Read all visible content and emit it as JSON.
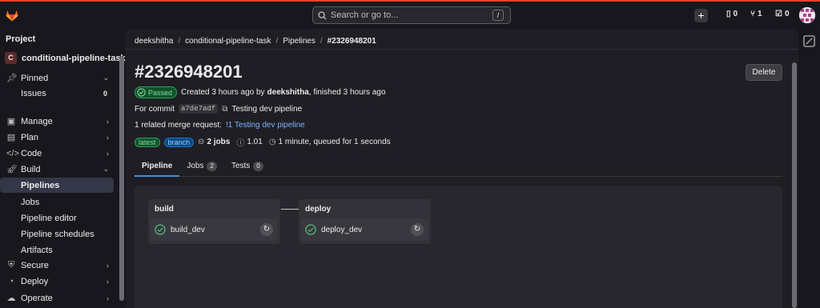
{
  "topbar": {
    "search_placeholder": "Search or go to...",
    "search_shortcut": "/",
    "issues_count": "0",
    "mr_count": "1",
    "todo_count": "0"
  },
  "sidebar": {
    "section_label": "Project",
    "repo_initial": "C",
    "repo_name": "conditional-pipeline-task",
    "items": {
      "pinned": "Pinned",
      "issues": "Issues",
      "issues_count": "0",
      "manage": "Manage",
      "plan": "Plan",
      "code": "Code",
      "build": "Build",
      "pipelines": "Pipelines",
      "jobs": "Jobs",
      "pipeline_editor": "Pipeline editor",
      "pipeline_schedules": "Pipeline schedules",
      "artifacts": "Artifacts",
      "secure": "Secure",
      "deploy": "Deploy",
      "operate": "Operate"
    }
  },
  "breadcrumb": {
    "user": "deekshitha",
    "project": "conditional-pipeline-task",
    "section": "Pipelines",
    "current": "#2326948201"
  },
  "pipeline": {
    "title": "#2326948201",
    "delete_label": "Delete",
    "status": "Passed",
    "created_text": "Created 3 hours ago by",
    "author": "deekshitha",
    "finished_text": ", finished 3 hours ago",
    "commit_prefix": "For commit",
    "commit_sha": "a7de7adf",
    "commit_message": "Testing dev pipeline",
    "mr_prefix": "1 related merge request:",
    "mr_link": "!1 Testing dev pipeline",
    "tag_latest": "latest",
    "tag_branch": "branch",
    "jobs_count": "2 jobs",
    "compute": "1.01",
    "duration": "1 minute, queued for 1 seconds"
  },
  "tabs": [
    {
      "label": "Pipeline"
    },
    {
      "label": "Jobs",
      "count": "2"
    },
    {
      "label": "Tests",
      "count": "0"
    }
  ],
  "stages": [
    {
      "name": "build",
      "job": "build_dev"
    },
    {
      "name": "deploy",
      "job": "deploy_dev"
    }
  ],
  "colors": {
    "accent": "#428fdc",
    "success": "#2da160",
    "brand": "#e24329"
  }
}
